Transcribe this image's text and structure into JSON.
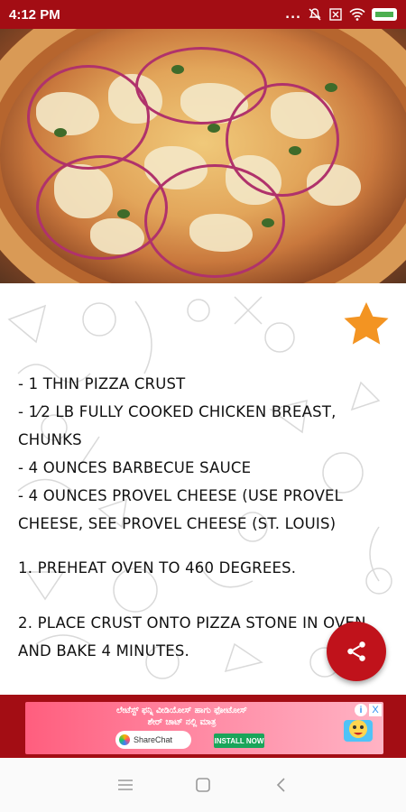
{
  "status_bar": {
    "time": "4:12 PM",
    "dots": "...",
    "icons": [
      "mute-icon",
      "close-box-icon",
      "wifi-icon",
      "battery-icon"
    ],
    "color": "#a30d14"
  },
  "hero": {
    "image": "bbq-chicken-pizza-photo"
  },
  "favorite": {
    "icon": "star-icon",
    "color": "#f39422"
  },
  "recipe": {
    "ingredients": [
      "- 1 thin pizza crust",
      "- 1⁄2 lb fully cooked chicken breast, chunks",
      "- 4 ounces barbecue sauce",
      "- 4 ounces provel cheese (use provel cheese, see provel cheese (st. louis)"
    ],
    "steps": [
      "1. Preheat oven to 460 degrees.",
      "2. Place crust onto pizza stone in oven and bake 4 minutes."
    ]
  },
  "share": {
    "icon": "share-icon",
    "color": "#c0121b"
  },
  "ad": {
    "headline_line1": "ಲೇಟೆಸ್ಟ್ ಫನ್ನಿ ವೀಡಿಯೋಸ್ ಹಾಗು ಫೋಟೋಸ್",
    "headline_line2": "ಶೇರ್ ಚಾಟ್ ನಲ್ಲಿ ಮಾತ್ರ",
    "brand": "ShareChat",
    "cta": "INSTALL NOW",
    "info": "i",
    "close": "X"
  },
  "nav": {
    "icons": [
      "menu-icon",
      "home-square-icon",
      "back-icon"
    ]
  }
}
